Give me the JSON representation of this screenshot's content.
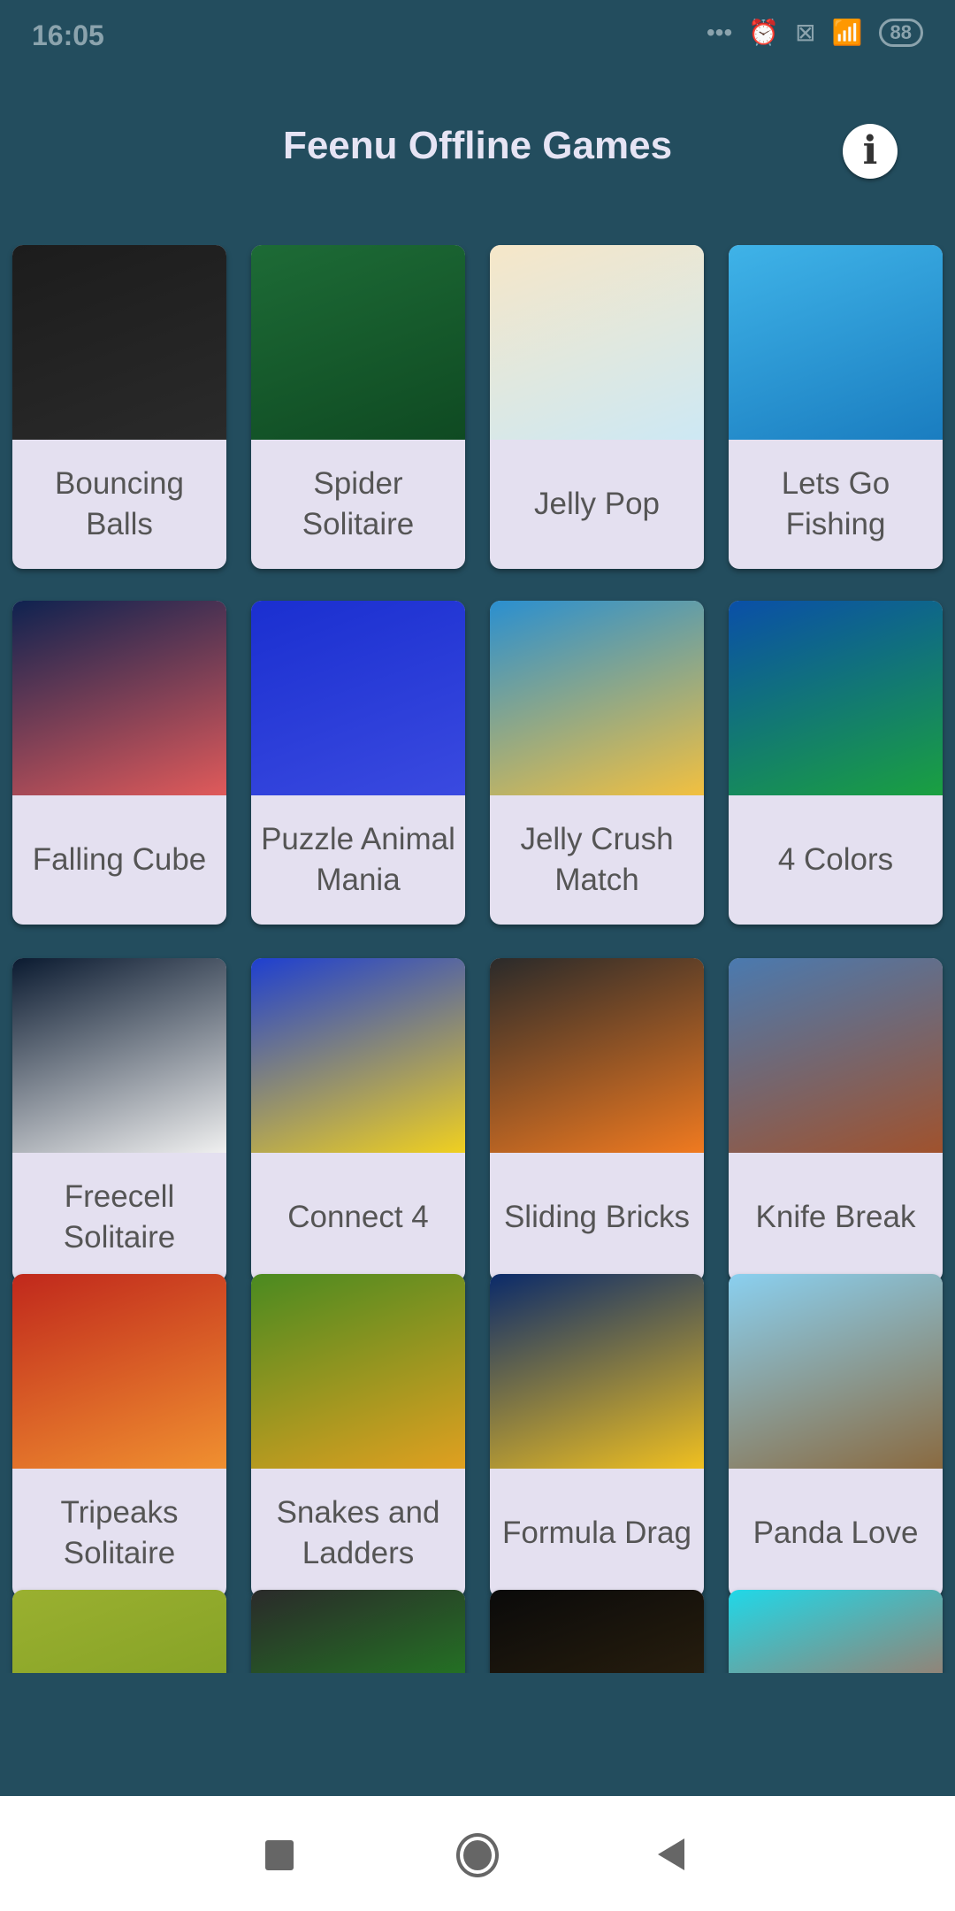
{
  "status_bar": {
    "time": "16:05",
    "battery": "88",
    "icons": [
      "more-dots-icon",
      "alarm-icon",
      "sim-x-icon",
      "wifi-icon",
      "battery-icon"
    ]
  },
  "header": {
    "title": "Feenu Offline Games",
    "info_icon": "info-icon"
  },
  "games": [
    {
      "label": "Bouncing Balls",
      "colors": [
        "#1c1c1c",
        "#2a2a2a"
      ]
    },
    {
      "label": "Spider Solitaire",
      "colors": [
        "#1d6b36",
        "#0f4a22"
      ]
    },
    {
      "label": "Jelly Pop",
      "colors": [
        "#f6e7c8",
        "#cde8f4"
      ]
    },
    {
      "label": "Lets Go Fishing",
      "colors": [
        "#3fb3e8",
        "#1a7dc0"
      ]
    },
    {
      "label": "Falling Cube",
      "colors": [
        "#0e2250",
        "#e05a5a"
      ]
    },
    {
      "label": "Puzzle Animal Mania",
      "colors": [
        "#1a2fd0",
        "#3a4ae0"
      ]
    },
    {
      "label": "Jelly Crush Match",
      "colors": [
        "#2a8fd0",
        "#f2c040"
      ]
    },
    {
      "label": "4 Colors",
      "colors": [
        "#0a4fa8",
        "#1aa040"
      ]
    },
    {
      "label": "Freecell Solitaire",
      "colors": [
        "#0a1a30",
        "#f0f0f0"
      ]
    },
    {
      "label": "Connect 4",
      "colors": [
        "#1e3fd0",
        "#f0d020"
      ]
    },
    {
      "label": "Sliding Bricks",
      "colors": [
        "#2a2a2a",
        "#f07a20"
      ]
    },
    {
      "label": "Knife Break",
      "colors": [
        "#4a7ab0",
        "#a0522d"
      ]
    },
    {
      "label": "Tripeaks Solitaire",
      "colors": [
        "#c0281c",
        "#f09030"
      ]
    },
    {
      "label": "Snakes and Ladders",
      "colors": [
        "#4a8a20",
        "#e0a020"
      ]
    },
    {
      "label": "Formula Drag",
      "colors": [
        "#0a2a6a",
        "#f0c020"
      ]
    },
    {
      "label": "Panda Love",
      "colors": [
        "#8ad0f0",
        "#8a6a40"
      ]
    },
    {
      "label": "",
      "colors": [
        "#9ab030",
        "#7a9a20"
      ]
    },
    {
      "label": "",
      "colors": [
        "#2a2a2a",
        "#20a020"
      ]
    },
    {
      "label": "",
      "colors": [
        "#0a0a0a",
        "#3a2a10"
      ]
    },
    {
      "label": "",
      "colors": [
        "#20d8e8",
        "#e04a2a"
      ]
    }
  ],
  "nav_bar": {
    "buttons": [
      "recents-square-icon",
      "home-circle-icon",
      "back-triangle-icon"
    ]
  }
}
